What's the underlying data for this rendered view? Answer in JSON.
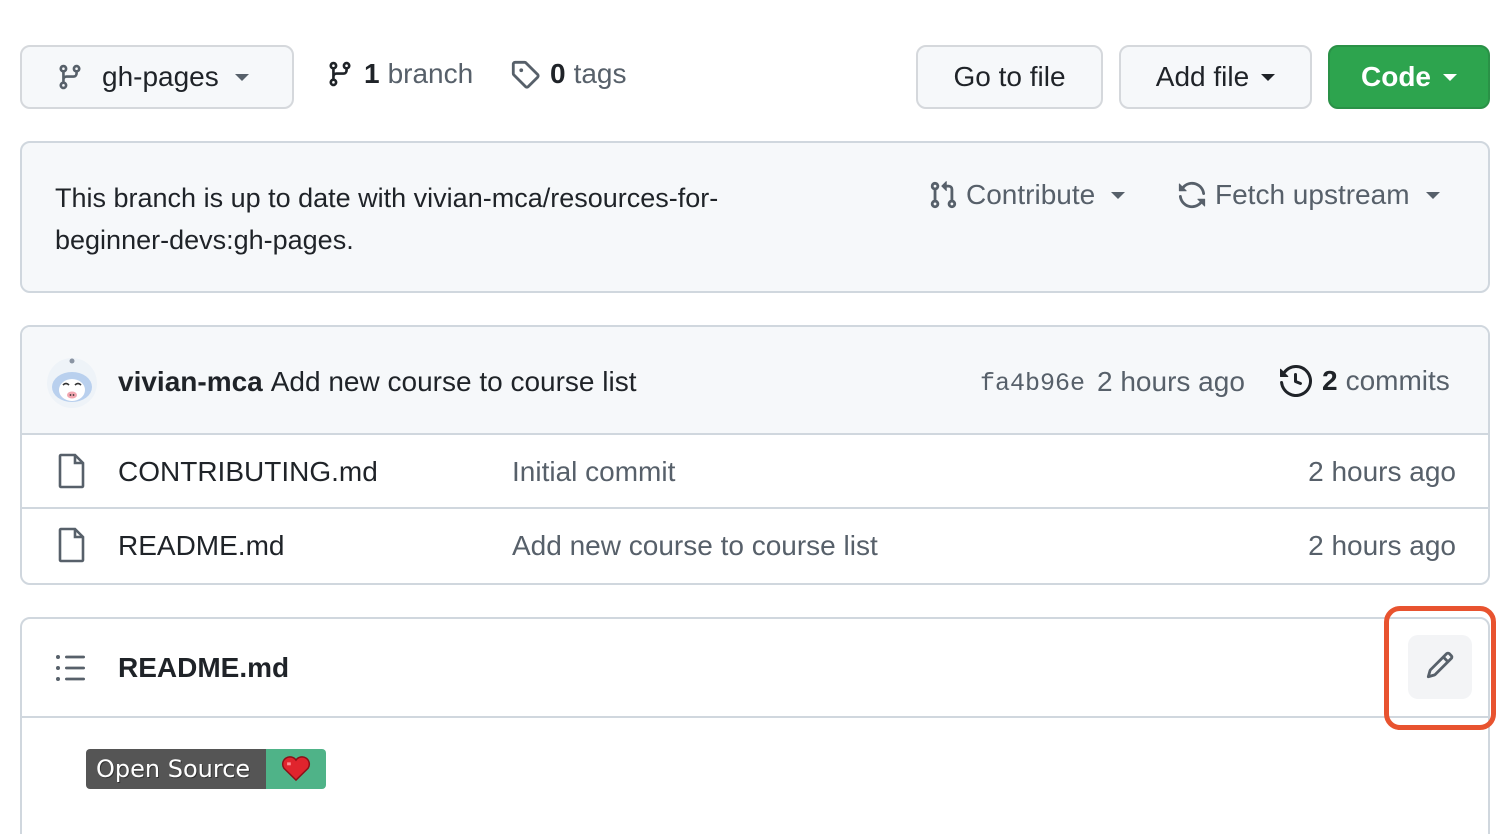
{
  "toolbar": {
    "branch_name": "gh-pages",
    "branch_count": "1",
    "branch_label": "branch",
    "tag_count": "0",
    "tag_label": "tags",
    "goto_file": "Go to file",
    "add_file": "Add file",
    "code": "Code",
    "code_color": "#2da44e"
  },
  "banner": {
    "message": "This branch is up to date with vivian-mca/resources-for-beginner-devs:gh-pages.",
    "contribute": "Contribute",
    "fetch_upstream": "Fetch upstream"
  },
  "latest_commit": {
    "author": "vivian-mca",
    "message": "Add new course to course list",
    "sha": "fa4b96e",
    "time": "2 hours ago",
    "commit_count": "2",
    "commit_label": "commits"
  },
  "files": [
    {
      "name": "CONTRIBUTING.md",
      "message": "Initial commit",
      "time": "2 hours ago",
      "icon": "file-icon"
    },
    {
      "name": "README.md",
      "message": "Add new course to course list",
      "time": "2 hours ago",
      "icon": "file-icon"
    }
  ],
  "readme": {
    "title": "README.md",
    "edit_icon": "pencil-icon",
    "highlight_color": "#e8532f",
    "badge_label": "Open Source",
    "badge_icon": "heart-icon"
  }
}
